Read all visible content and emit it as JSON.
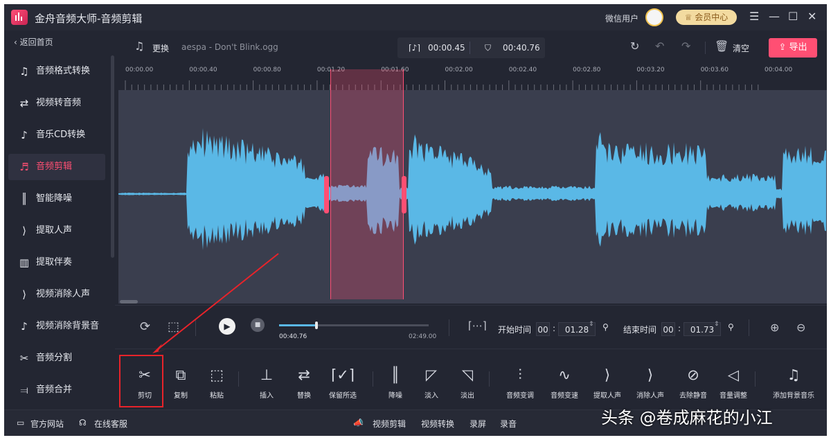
{
  "app": {
    "title": "金舟音频大师-音频剪辑",
    "user_label": "微信用户",
    "vip_label": "会员中心",
    "window_controls": [
      "menu-icon",
      "minimize-icon",
      "maximize-icon",
      "close-icon"
    ]
  },
  "sidebar": {
    "back_label": "返回首页",
    "items": [
      {
        "label": "音频格式转换",
        "icon": "♫"
      },
      {
        "label": "视频转音频",
        "icon": "⇄"
      },
      {
        "label": "音乐CD转换",
        "icon": "♪"
      },
      {
        "label": "音频剪辑",
        "icon": "♬",
        "active": true
      },
      {
        "label": "智能降噪",
        "icon": "║"
      },
      {
        "label": "提取人声",
        "icon": "⟩"
      },
      {
        "label": "提取伴奏",
        "icon": "▥"
      },
      {
        "label": "视频消除人声",
        "icon": "⟩"
      },
      {
        "label": "视频消除背景音",
        "icon": "♪"
      },
      {
        "label": "音频分割",
        "icon": "✂"
      },
      {
        "label": "音频合并",
        "icon": "⫤"
      }
    ]
  },
  "toolbar": {
    "replace_label": "更换",
    "file_name": "aespa - Don't Blink.ogg",
    "selection_duration": "00:00.45",
    "total_duration": "00:40.76",
    "clear_label": "清空",
    "export_label": "导出"
  },
  "ruler": {
    "ticks": [
      "00:00.00",
      "00:00.40",
      "00:00.80",
      "00:01.20",
      "00:01.60",
      "00:02.00",
      "00:02.40",
      "00:02.80",
      "00:03.20",
      "00:03.60",
      "00:04.00"
    ]
  },
  "transport": {
    "current_time": "00:40.76",
    "end_time": "02:49.00",
    "progress": 0.25,
    "start_label": "开始时间",
    "start_min": "00",
    "start_sec": "01.28",
    "end_label": "结束时间",
    "end_min": "00",
    "end_sec": "01.73",
    "zoom_in": "zoom-in-icon",
    "zoom_out": "zoom-out-icon"
  },
  "tools": [
    {
      "label": "剪切",
      "icon": "✂"
    },
    {
      "label": "复制",
      "icon": "⧉"
    },
    {
      "label": "粘贴",
      "icon": "⬚"
    },
    {
      "label": "插入",
      "icon": "⊥"
    },
    {
      "label": "替换",
      "icon": "⇄"
    },
    {
      "label": "保留所选",
      "icon": "⌈✓⌉"
    },
    {
      "label": "降噪",
      "icon": "║"
    },
    {
      "label": "淡入",
      "icon": "◸"
    },
    {
      "label": "淡出",
      "icon": "◹"
    },
    {
      "label": "音频变调",
      "icon": "⫶"
    },
    {
      "label": "音频变速",
      "icon": "∿"
    },
    {
      "label": "提取人声",
      "icon": "⟩"
    },
    {
      "label": "消除人声",
      "icon": "⟩"
    },
    {
      "label": "去除静音",
      "icon": "⊘"
    },
    {
      "label": "音量调整",
      "icon": "◁"
    },
    {
      "label": "添加背景音乐",
      "icon": "♫"
    }
  ],
  "bottom": {
    "website": "官方网站",
    "service": "在线客服",
    "links": [
      "视频剪辑",
      "视频转换",
      "录屏",
      "录音"
    ]
  },
  "watermark": "头条 @卷成麻花的小江",
  "colors": {
    "accent": "#ff4f73",
    "wave": "#5ab8e6",
    "background": "#232632"
  }
}
